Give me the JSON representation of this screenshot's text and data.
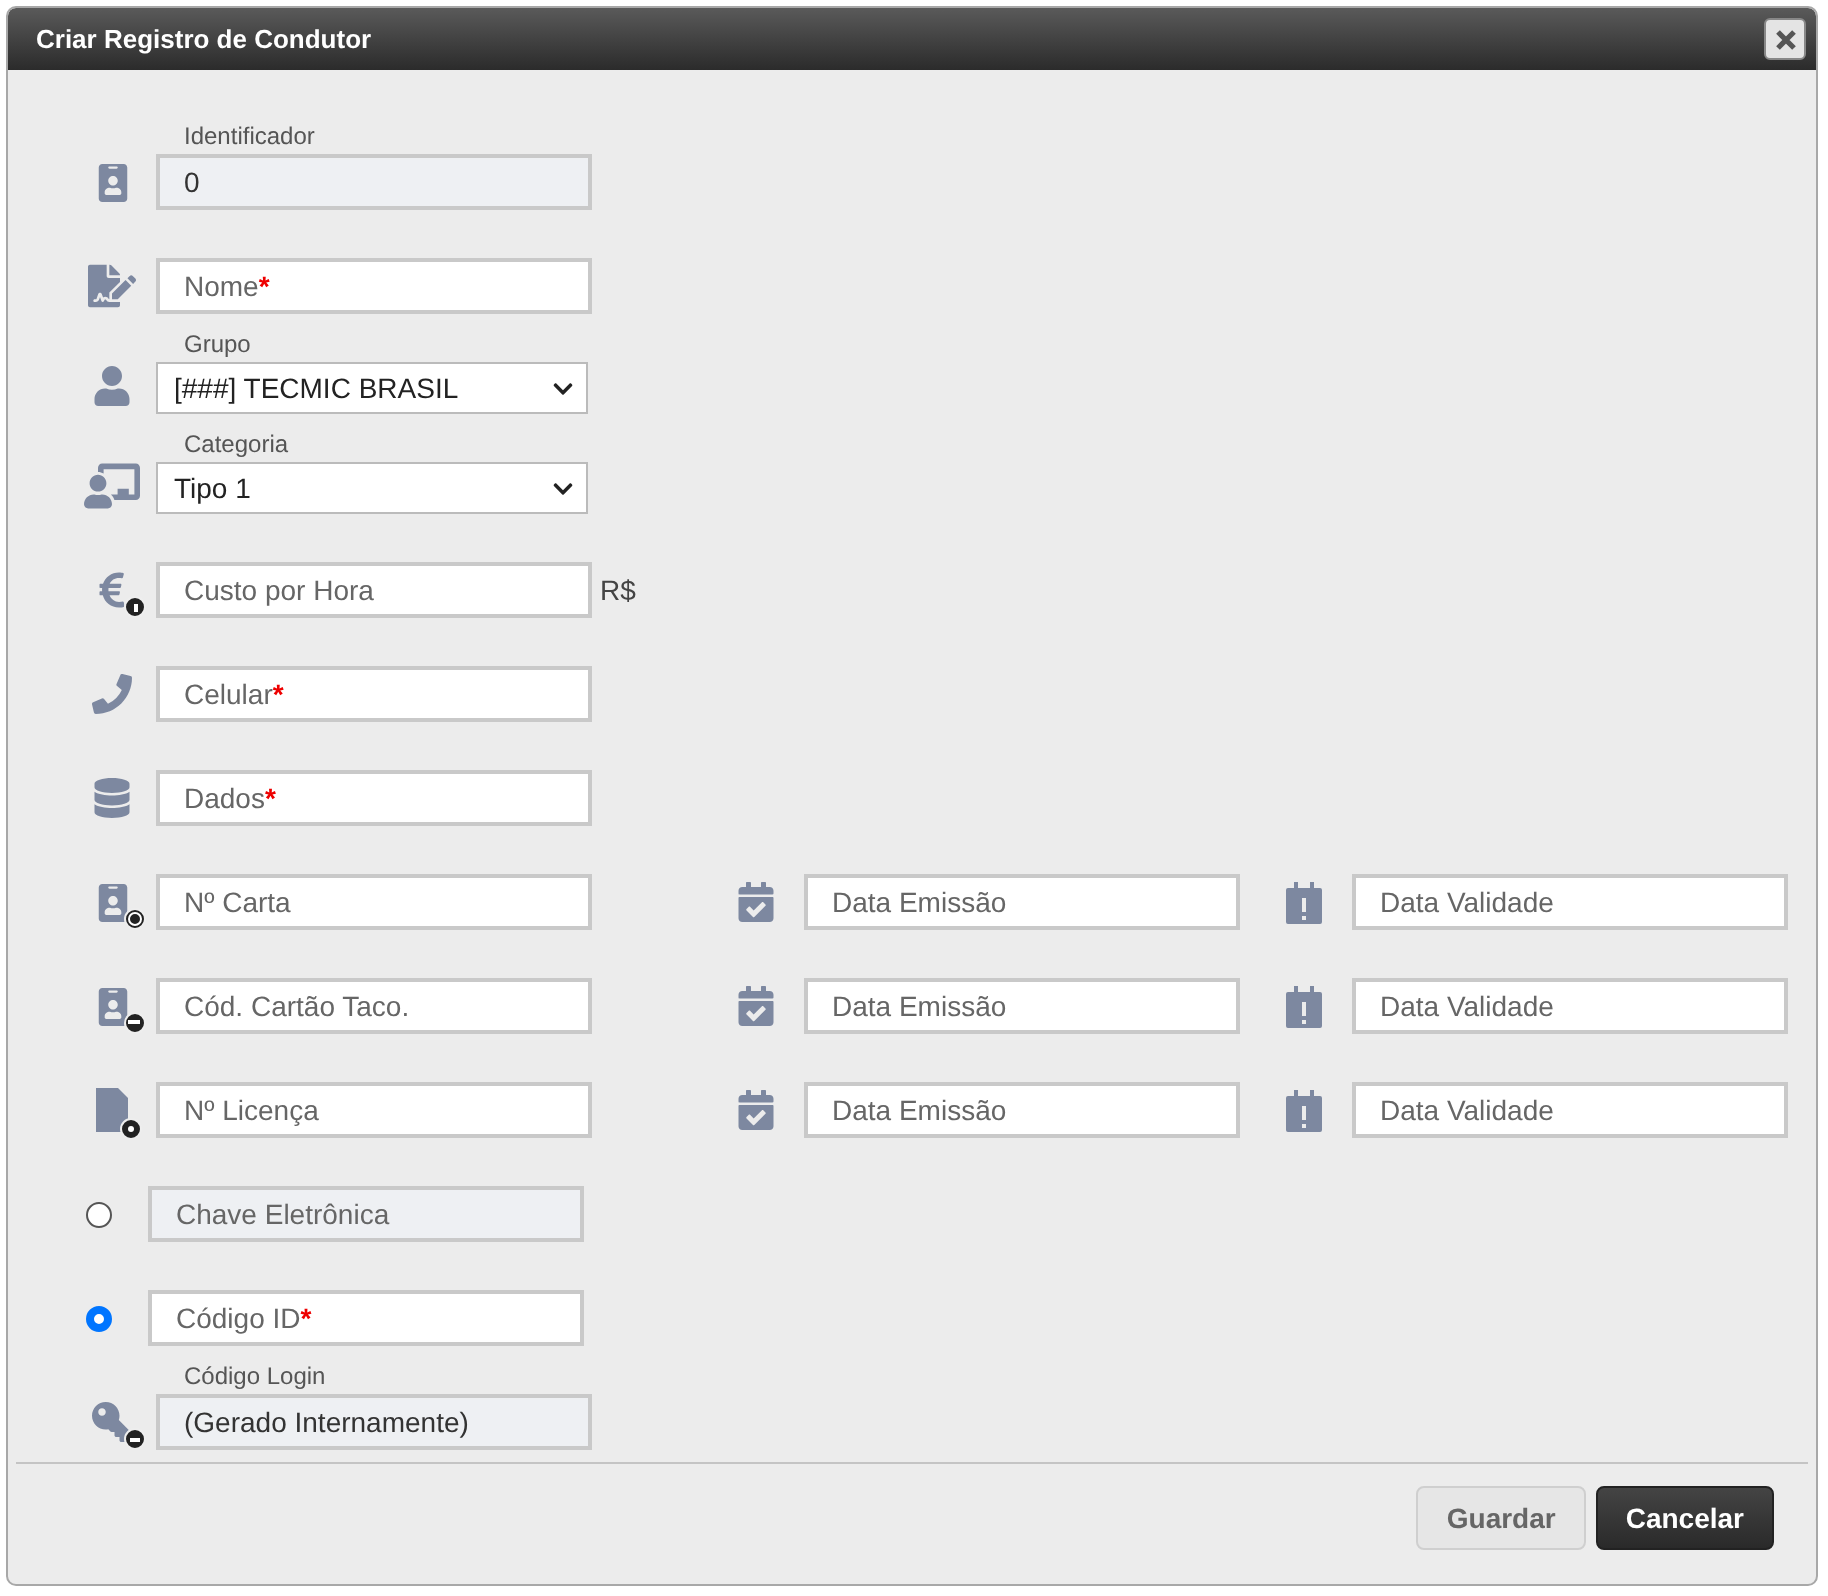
{
  "window": {
    "title": "Criar Registro de Condutor"
  },
  "fields": [
    {
      "kind": "text",
      "label": "Identificador",
      "value": "0",
      "disabled": true
    },
    {
      "kind": "text",
      "placeholder": "Nome",
      "required_mark": "*",
      "disabled": false
    },
    {
      "kind": "select",
      "label": "Grupo",
      "value": "[###] TECMIC BRASIL"
    },
    {
      "kind": "select",
      "label": "Categoria",
      "value": "Tipo 1"
    },
    {
      "kind": "text",
      "placeholder": "Custo por Hora",
      "suffix": "R$",
      "disabled": false
    },
    {
      "kind": "text",
      "placeholder": "Celular",
      "required_mark": "*",
      "disabled": false
    },
    {
      "kind": "text",
      "placeholder": "Dados",
      "required_mark": "*",
      "disabled": false
    },
    {
      "kind": "dated",
      "placeholder": "Nº Carta",
      "dates": [
        {
          "placeholder": "Data Emissão"
        },
        {
          "placeholder": "Data Validade"
        }
      ]
    },
    {
      "kind": "dated",
      "placeholder": "Cód. Cartão Taco.",
      "dates": [
        {
          "placeholder": "Data Emissão"
        },
        {
          "placeholder": "Data Validade"
        }
      ]
    },
    {
      "kind": "dated",
      "placeholder": "Nº Licença",
      "dates": [
        {
          "placeholder": "Data Emissão"
        },
        {
          "placeholder": "Data Validade"
        }
      ]
    },
    {
      "kind": "radio",
      "selected": false,
      "placeholder": "Chave Eletrônica",
      "disabled": true
    },
    {
      "kind": "radio",
      "selected": true,
      "placeholder": "Código ID",
      "required_mark": "*",
      "disabled": false
    },
    {
      "kind": "text",
      "label": "Código Login",
      "value": "(Gerado Internamente)",
      "disabled": true
    }
  ],
  "buttons": [
    {
      "label": "Guardar",
      "primary": false
    },
    {
      "label": "Cancelar",
      "primary": true
    }
  ]
}
